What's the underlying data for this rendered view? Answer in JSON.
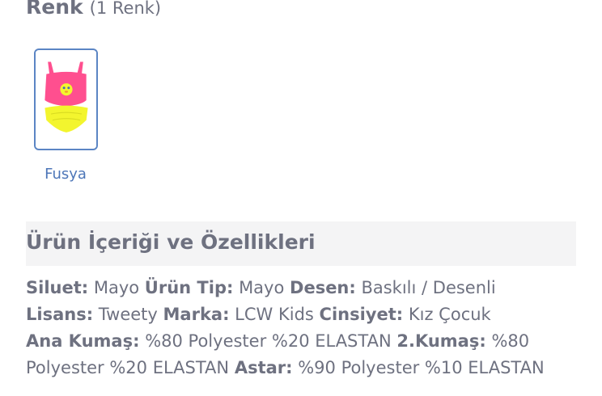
{
  "color_section": {
    "title": "Renk",
    "count_label": "(1 Renk)",
    "swatches": [
      {
        "label": "Fusya",
        "image": "pink-yellow-swimsuit-tweety-thumbnail"
      }
    ]
  },
  "features": {
    "title": "Ürün İçeriği ve Özellikleri",
    "attributes": [
      {
        "key": "Siluet:",
        "value": "Mayo"
      },
      {
        "key": "Ürün Tip:",
        "value": "Mayo"
      },
      {
        "key": "Desen:",
        "value": "Baskılı / Desenli"
      },
      {
        "key": "Lisans:",
        "value": "Tweety"
      },
      {
        "key": "Marka:",
        "value": "LCW Kids"
      },
      {
        "key": "Cinsiyet:",
        "value": "Kız Çocuk"
      },
      {
        "key": "Ana Kumaş:",
        "value": "%80 Polyester %20 ELASTAN"
      },
      {
        "key": "2.Kumaş:",
        "value": "%80 Polyester %20 ELASTAN"
      },
      {
        "key": "Astar:",
        "value": "%90 Polyester %10 ELASTAN"
      }
    ]
  },
  "colors": {
    "text": "#6e7180",
    "link": "#4d76b8",
    "swatch_border": "#5b85c4",
    "panel_bg": "#f4f4f5",
    "swimsuit_pink": "#ff4f8f",
    "swimsuit_yellow": "#f3f52e"
  }
}
